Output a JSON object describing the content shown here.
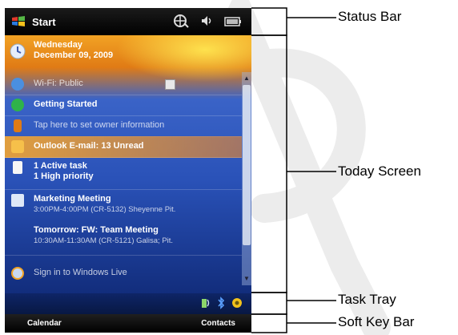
{
  "status_bar": {
    "start_label": "Start"
  },
  "today": {
    "date_line1": "Wednesday",
    "date_line2": "December 09, 2009",
    "items": [
      {
        "label": "Wi-Fi: Public"
      },
      {
        "label": "Getting Started"
      },
      {
        "label": "Tap here to set owner information"
      },
      {
        "label": "Outlook E-mail: 13 Unread"
      },
      {
        "line1": "1 Active task",
        "line2": "1 High priority"
      },
      {
        "line1": "Marketing Meeting",
        "line2": "3:00PM-4:00PM (CR-5132) Sheyenne Pit."
      },
      {
        "line1": "Tomorrow: FW: Team Meeting",
        "line2": "10:30AM-11:30AM (CR-5121) Galisa; Pit."
      },
      {
        "label": "Sign in to Windows Live"
      }
    ]
  },
  "soft_keys": {
    "left": "Calendar",
    "right": "Contacts"
  },
  "callouts": {
    "status_bar": "Status Bar",
    "today_screen": "Today Screen",
    "task_tray": "Task Tray",
    "soft_key_bar": "Soft Key Bar"
  },
  "colors": {
    "status_bar": "#000000",
    "today_top": "#f2a324",
    "today_bottom": "#122d7c",
    "highlight": "#ffaa28"
  },
  "icons": [
    "windows-logo-icon",
    "connectivity-icon",
    "volume-icon",
    "battery-icon",
    "calendar-icon",
    "wifi-icon",
    "getting-started-icon",
    "owner-icon",
    "mail-icon",
    "task-icon",
    "meeting-icon",
    "windows-live-icon",
    "bluetooth-icon",
    "wireless-icon",
    "settings-icon"
  ]
}
